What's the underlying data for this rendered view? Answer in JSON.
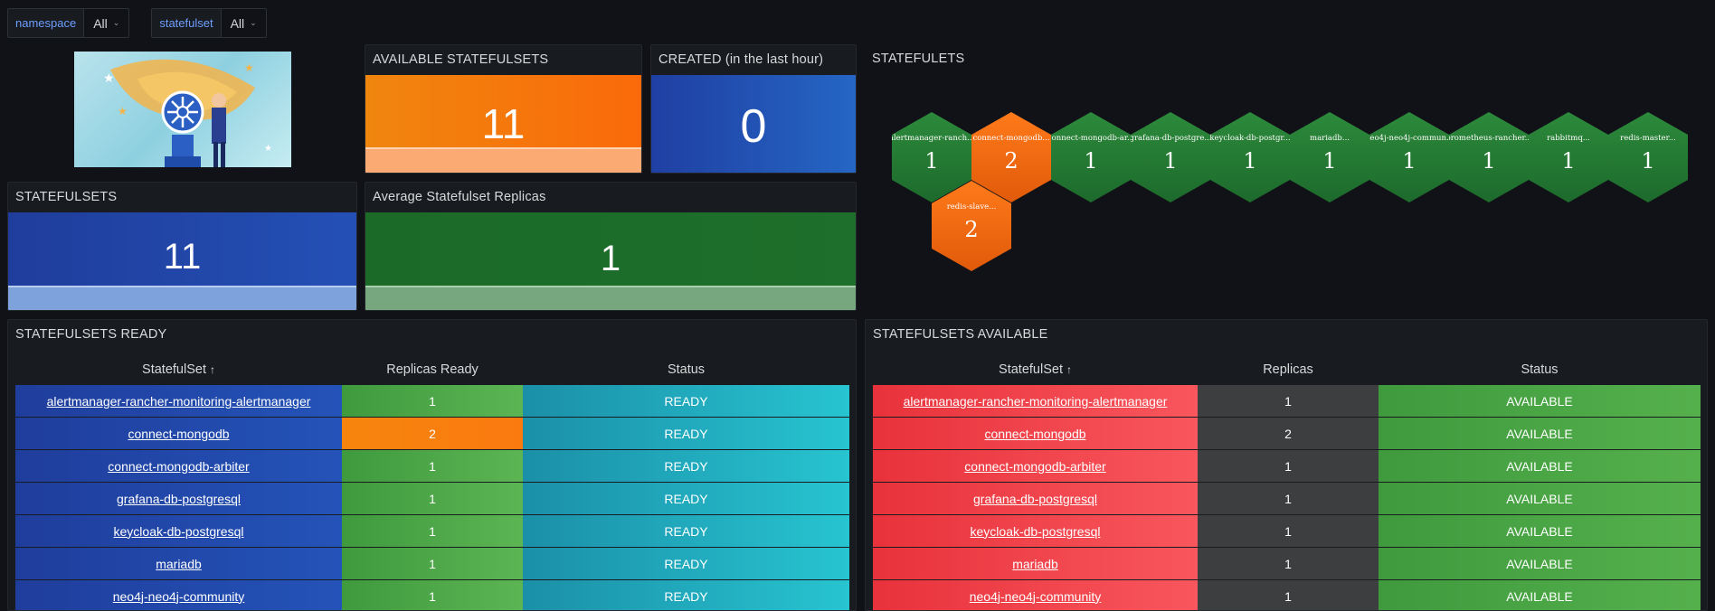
{
  "variables": [
    {
      "label": "namespace",
      "value": "All"
    },
    {
      "label": "statefulset",
      "value": "All"
    }
  ],
  "available_panel": {
    "title": "AVAILABLE STATEFULSETS",
    "value": "11"
  },
  "created_panel": {
    "title": "CREATED (in the last hour)",
    "value": "0"
  },
  "statefulsets_panel": {
    "title": "STATEFULSETS",
    "value": "11"
  },
  "avg_panel": {
    "title": "Average Statefulset Replicas",
    "value": "1"
  },
  "hex_panel": {
    "title": "STATEFULETS",
    "items": [
      {
        "label": "alertmanager-ranch...",
        "value": "1",
        "color": "green"
      },
      {
        "label": "connect-mongodb...",
        "value": "2",
        "color": "orange"
      },
      {
        "label": "connect-mongodb-ar...",
        "value": "1",
        "color": "green"
      },
      {
        "label": "grafana-db-postgre...",
        "value": "1",
        "color": "green"
      },
      {
        "label": "keycloak-db-postgr...",
        "value": "1",
        "color": "green"
      },
      {
        "label": "mariadb...",
        "value": "1",
        "color": "green"
      },
      {
        "label": "neo4j-neo4j-commun...",
        "value": "1",
        "color": "green"
      },
      {
        "label": "prometheus-rancher...",
        "value": "1",
        "color": "green"
      },
      {
        "label": "rabbitmq...",
        "value": "1",
        "color": "green"
      },
      {
        "label": "redis-master...",
        "value": "1",
        "color": "green"
      },
      {
        "label": "redis-slave...",
        "value": "2",
        "color": "orange"
      }
    ]
  },
  "ready_table": {
    "title": "STATEFULSETS READY",
    "columns": [
      "StatefulSet",
      "Replicas Ready",
      "Status"
    ],
    "sort_arrow": "↑",
    "rows": [
      {
        "name": "alertmanager-rancher-monitoring-alertmanager",
        "replicas": "1",
        "status": "READY",
        "warn": false
      },
      {
        "name": "connect-mongodb",
        "replicas": "2",
        "status": "READY",
        "warn": true
      },
      {
        "name": "connect-mongodb-arbiter",
        "replicas": "1",
        "status": "READY",
        "warn": false
      },
      {
        "name": "grafana-db-postgresql",
        "replicas": "1",
        "status": "READY",
        "warn": false
      },
      {
        "name": "keycloak-db-postgresql",
        "replicas": "1",
        "status": "READY",
        "warn": false
      },
      {
        "name": "mariadb",
        "replicas": "1",
        "status": "READY",
        "warn": false
      },
      {
        "name": "neo4j-neo4j-community",
        "replicas": "1",
        "status": "READY",
        "warn": false
      }
    ]
  },
  "available_table": {
    "title": "STATEFULSETS AVAILABLE",
    "columns": [
      "StatefulSet",
      "Replicas",
      "Status"
    ],
    "sort_arrow": "↑",
    "rows": [
      {
        "name": "alertmanager-rancher-monitoring-alertmanager",
        "replicas": "1",
        "status": "AVAILABLE"
      },
      {
        "name": "connect-mongodb",
        "replicas": "2",
        "status": "AVAILABLE"
      },
      {
        "name": "connect-mongodb-arbiter",
        "replicas": "1",
        "status": "AVAILABLE"
      },
      {
        "name": "grafana-db-postgresql",
        "replicas": "1",
        "status": "AVAILABLE"
      },
      {
        "name": "keycloak-db-postgresql",
        "replicas": "1",
        "status": "AVAILABLE"
      },
      {
        "name": "mariadb",
        "replicas": "1",
        "status": "AVAILABLE"
      },
      {
        "name": "neo4j-neo4j-community",
        "replicas": "1",
        "status": "AVAILABLE"
      }
    ]
  }
}
